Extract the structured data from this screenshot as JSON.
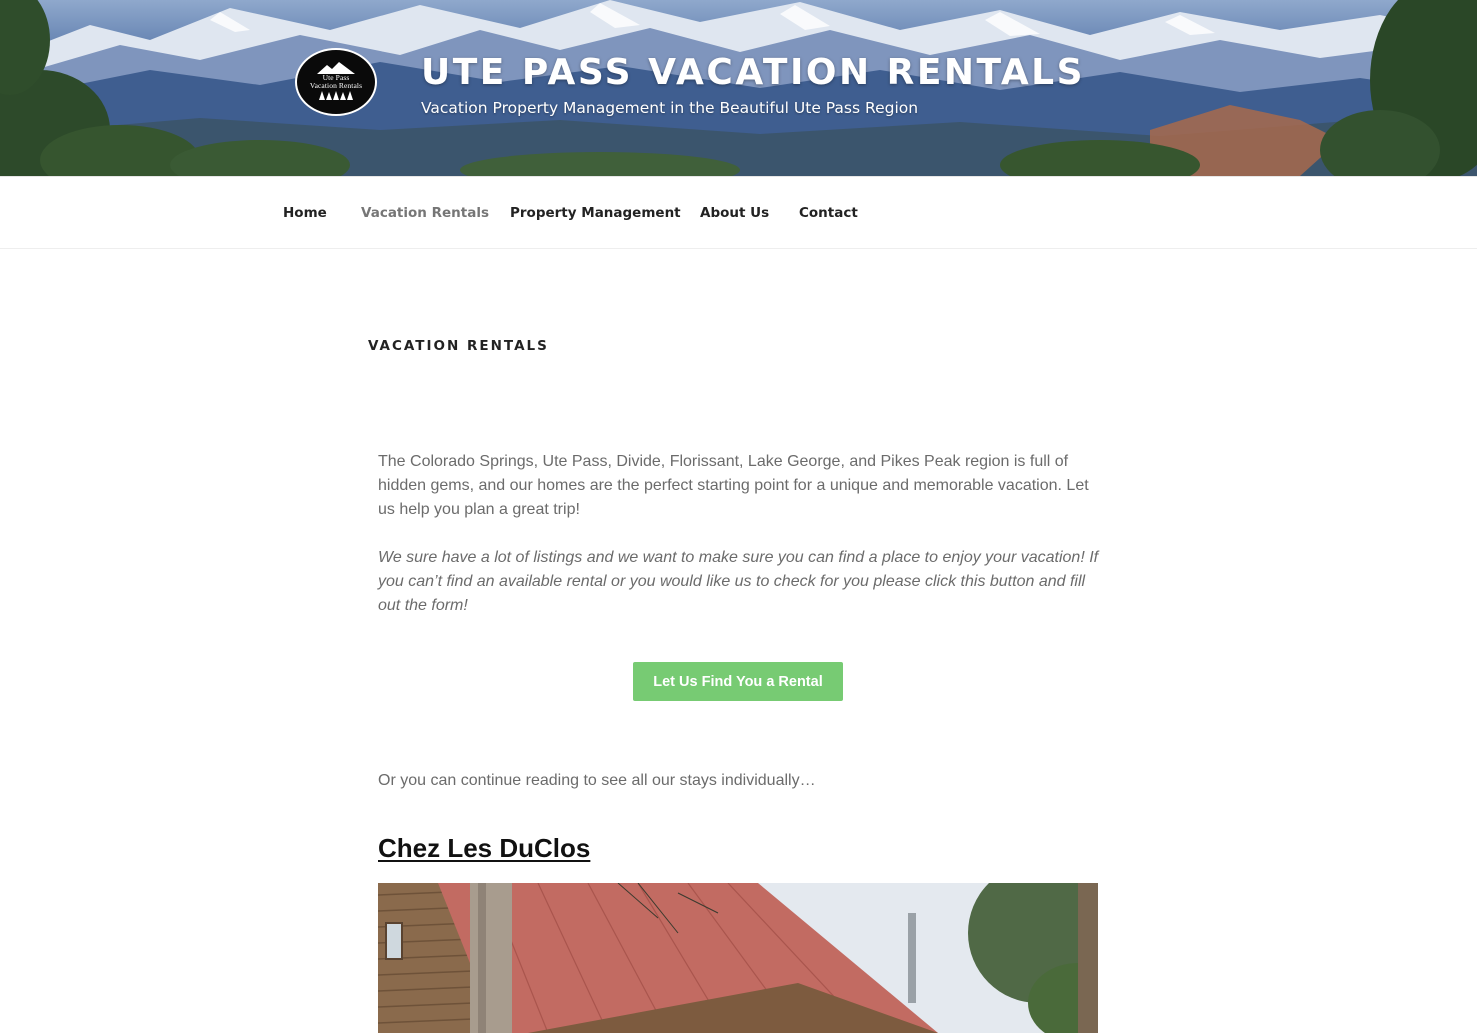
{
  "header": {
    "logo": {
      "line1": "Ute Pass",
      "line2": "Vacation Rentals"
    },
    "site_title": "UTE PASS VACATION RENTALS",
    "tagline": "Vacation Property Management in the Beautiful Ute Pass Region"
  },
  "nav": {
    "items": [
      {
        "label": "Home",
        "current": false
      },
      {
        "label": "Vacation Rentals",
        "current": true
      },
      {
        "label": "Property Management",
        "current": false
      },
      {
        "label": "About Us",
        "current": false
      },
      {
        "label": "Contact",
        "current": false
      }
    ]
  },
  "main": {
    "page_title": "VACATION RENTALS",
    "intro": "The Colorado Springs, Ute Pass, Divide, Florissant, Lake George, and Pikes Peak region is full of hidden gems, and our homes are the perfect starting point for a unique and memorable vacation. Let us help you plan a great trip!",
    "note": "We sure have a lot of listings and we want to make sure you can find a place to enjoy your vacation! If you can’t find an available rental or you would like us to check for you please click this button and fill out the form!",
    "cta_label": "Let Us Find You a Rental",
    "continue_text": "Or you can continue reading to see all our stays individually…",
    "listings": [
      {
        "title": "Chez Les DuClos"
      }
    ]
  },
  "colors": {
    "cta": "#77cb73",
    "nav_current": "#767676",
    "body_text": "#6b6b6b"
  }
}
